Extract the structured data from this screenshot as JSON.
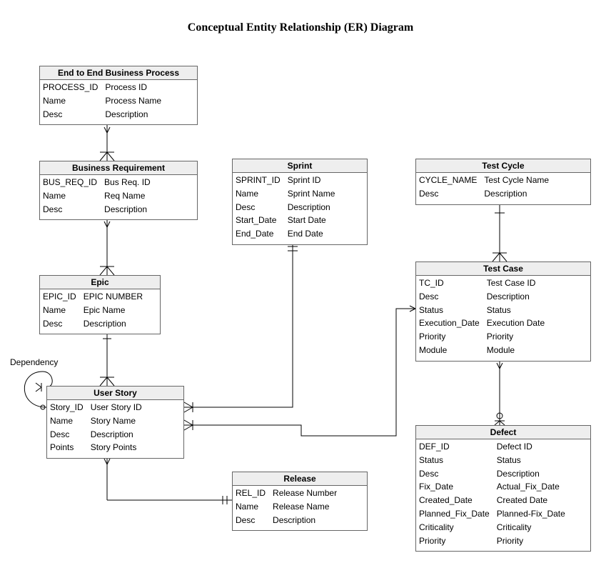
{
  "title": "Conceptual Entity Relationship (ER) Diagram",
  "dependency_label": "Dependency",
  "entities": {
    "process": {
      "title": "End to End Business Process",
      "attrs": [
        {
          "key": "PROCESS_ID",
          "desc": "Process ID"
        },
        {
          "key": "Name",
          "desc": "Process Name"
        },
        {
          "key": "Desc",
          "desc": "Description"
        }
      ]
    },
    "business_req": {
      "title": "Business Requirement",
      "attrs": [
        {
          "key": "BUS_REQ_ID",
          "desc": "Bus Req. ID"
        },
        {
          "key": "Name",
          "desc": "Req Name"
        },
        {
          "key": "Desc",
          "desc": "Description"
        }
      ]
    },
    "sprint": {
      "title": "Sprint",
      "attrs": [
        {
          "key": "SPRINT_ID",
          "desc": "Sprint ID"
        },
        {
          "key": "Name",
          "desc": "Sprint Name"
        },
        {
          "key": "Desc",
          "desc": "Description"
        },
        {
          "key": "Start_Date",
          "desc": "Start Date"
        },
        {
          "key": "End_Date",
          "desc": "End Date"
        }
      ]
    },
    "test_cycle": {
      "title": "Test Cycle",
      "attrs": [
        {
          "key": "CYCLE_NAME",
          "desc": "Test Cycle Name"
        },
        {
          "key": "Desc",
          "desc": "Description"
        }
      ]
    },
    "epic": {
      "title": "Epic",
      "attrs": [
        {
          "key": "EPIC_ID",
          "desc": "EPIC NUMBER"
        },
        {
          "key": "Name",
          "desc": "Epic Name"
        },
        {
          "key": "Desc",
          "desc": "Description"
        }
      ]
    },
    "test_case": {
      "title": "Test Case",
      "attrs": [
        {
          "key": "TC_ID",
          "desc": "Test Case ID"
        },
        {
          "key": "Desc",
          "desc": "Description"
        },
        {
          "key": "Status",
          "desc": "Status"
        },
        {
          "key": "Execution_Date",
          "desc": "Execution Date"
        },
        {
          "key": "Priority",
          "desc": "Priority"
        },
        {
          "key": "Module",
          "desc": "Module"
        }
      ]
    },
    "user_story": {
      "title": "User Story",
      "attrs": [
        {
          "key": "Story_ID",
          "desc": "User Story ID"
        },
        {
          "key": "Name",
          "desc": "Story Name"
        },
        {
          "key": "Desc",
          "desc": "Description"
        },
        {
          "key": "Points",
          "desc": "Story Points"
        }
      ]
    },
    "release": {
      "title": "Release",
      "attrs": [
        {
          "key": "REL_ID",
          "desc": "Release Number"
        },
        {
          "key": "Name",
          "desc": "Release Name"
        },
        {
          "key": "Desc",
          "desc": "Description"
        }
      ]
    },
    "defect": {
      "title": "Defect",
      "attrs": [
        {
          "key": "DEF_ID",
          "desc": "Defect ID"
        },
        {
          "key": "Status",
          "desc": "Status"
        },
        {
          "key": "Desc",
          "desc": "Description"
        },
        {
          "key": "Fix_Date",
          "desc": "Actual_Fix_Date"
        },
        {
          "key": "Created_Date",
          "desc": "Created Date"
        },
        {
          "key": "Planned_Fix_Date",
          "desc": "Planned-Fix_Date"
        },
        {
          "key": "Criticality",
          "desc": "Criticality"
        },
        {
          "key": "Priority",
          "desc": "Priority"
        }
      ]
    }
  }
}
